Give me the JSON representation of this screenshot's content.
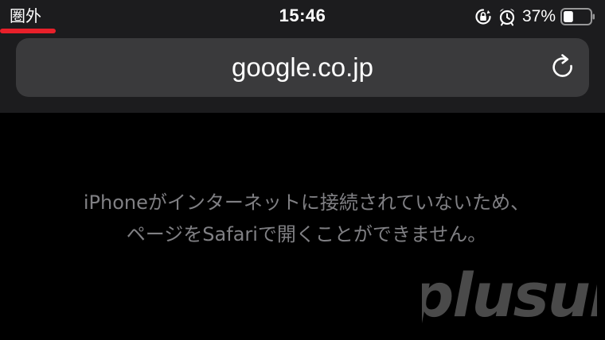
{
  "status_bar": {
    "carrier": "圏外",
    "time": "15:46",
    "battery_percent": "37%",
    "battery_level": 0.37,
    "icons": [
      "lock-rotation-icon",
      "alarm-icon",
      "battery-icon"
    ]
  },
  "url_bar": {
    "url": "google.co.jp",
    "reload_icon": "reload-icon"
  },
  "page": {
    "message": "iPhoneがインターネットに接続されていないため、ページをSafariで開くことができません。"
  },
  "watermark": {
    "text": "plusul"
  },
  "colors": {
    "background": "#000000",
    "toolbar": "#1c1c1e",
    "url_field": "#3a3a3c",
    "message_text": "#808084",
    "highlight_underline": "#e8202a",
    "watermark": "#4a4a4a"
  }
}
